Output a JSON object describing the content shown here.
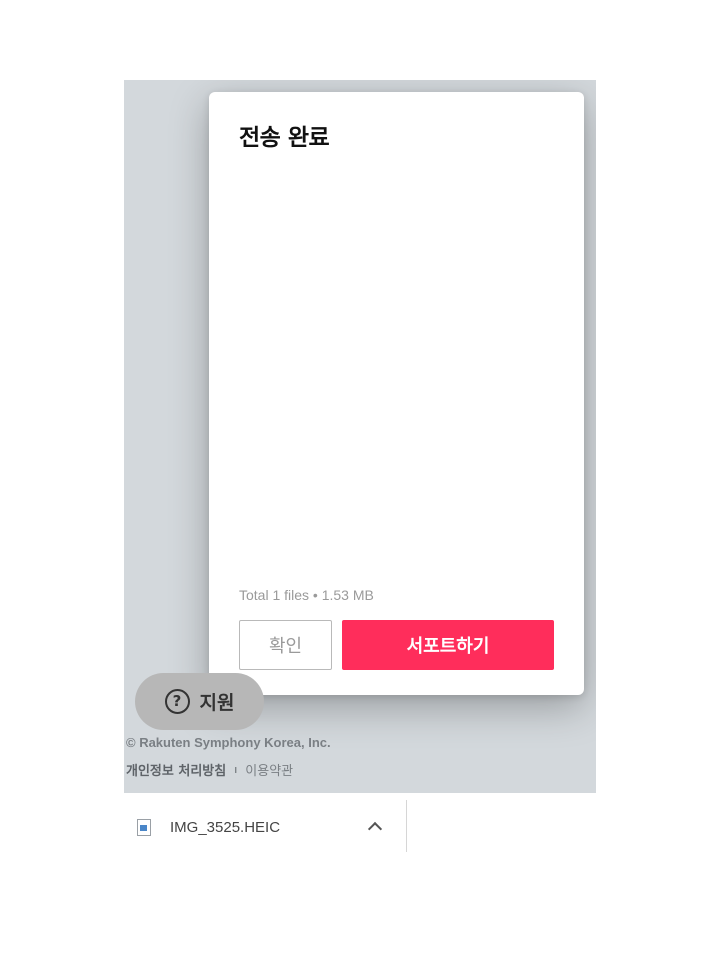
{
  "modal": {
    "title": "전송 완료",
    "summary": "Total 1 files • 1.53 MB",
    "confirm_label": "확인",
    "support_label": "서포트하기"
  },
  "help": {
    "icon": "question-circle-icon",
    "icon_glyph": "?",
    "label": "지원"
  },
  "footer": {
    "copyright": "© Rakuten Symphony Korea, Inc.",
    "privacy_label": "개인정보 처리방침",
    "separator": "ı",
    "terms_label": "이용약관"
  },
  "download": {
    "file_icon": "image-file-icon",
    "file_name": "IMG_3525.HEIC",
    "chevron_icon": "chevron-up-icon"
  },
  "colors": {
    "accent": "#ff2d5b",
    "backdrop": "#d3d8dc"
  }
}
